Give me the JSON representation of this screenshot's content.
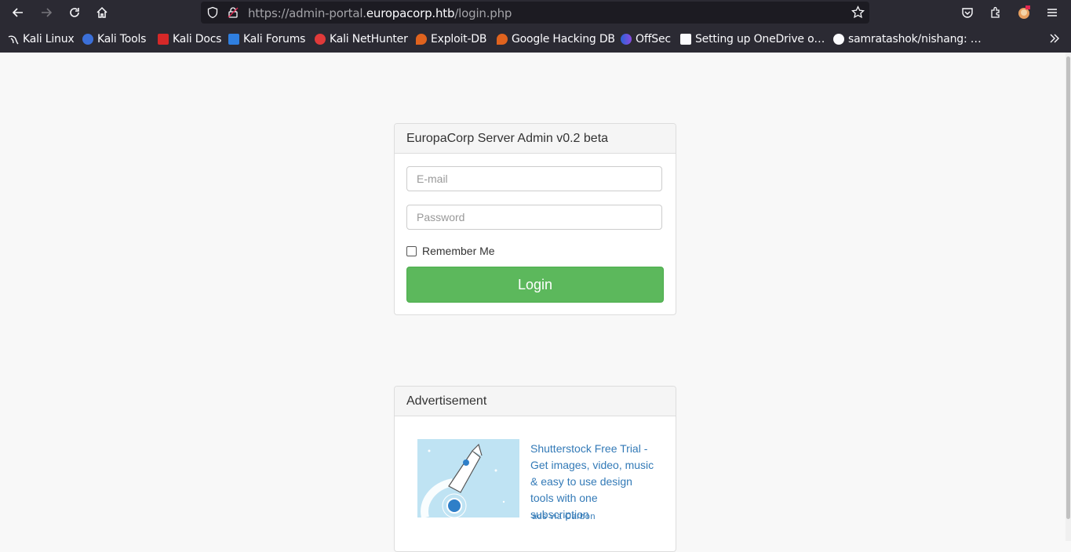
{
  "browser": {
    "url_prefix": "https://admin-portal.",
    "url_domain": "europacorp.htb",
    "url_path": "/login.php",
    "bookmarks": [
      {
        "label": "Kali Linux",
        "icon": "kali-dragon-icon"
      },
      {
        "label": "Kali Tools",
        "icon": "kali-tools-icon"
      },
      {
        "label": "Kali Docs",
        "icon": "kali-docs-icon"
      },
      {
        "label": "Kali Forums",
        "icon": "kali-forums-icon"
      },
      {
        "label": "Kali NetHunter",
        "icon": "kali-nethunter-icon"
      },
      {
        "label": "Exploit-DB",
        "icon": "exploit-db-icon"
      },
      {
        "label": "Google Hacking DB",
        "icon": "ghdb-icon"
      },
      {
        "label": "OffSec",
        "icon": "offsec-icon"
      },
      {
        "label": "Setting up OneDrive o…",
        "icon": "onedrive-page-icon"
      },
      {
        "label": "samratashok/nishang: …",
        "icon": "github-icon"
      }
    ]
  },
  "login": {
    "title": "EuropaCorp Server Admin v0.2 beta",
    "email_placeholder": "E-mail",
    "password_placeholder": "Password",
    "remember_label": "Remember Me",
    "login_label": "Login"
  },
  "ad": {
    "title": "Advertisement",
    "text": "Shutterstock Free Trial - Get images, video, music & easy to use design tools with one subscription",
    "via": "ads via Carbon"
  },
  "colors": {
    "login_button": "#5cb85c",
    "link": "#337ab7",
    "chrome": "#2b2a33"
  }
}
